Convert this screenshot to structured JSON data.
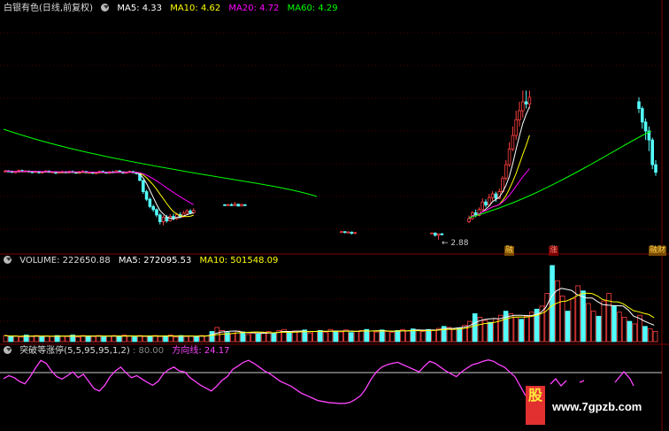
{
  "colors": {
    "background": "#000000",
    "up": "#ff4040",
    "down": "#54fcfc",
    "ma5": "#ffffff",
    "ma10": "#ffff00",
    "ma20": "#ff00ff",
    "ma60": "#00ff00",
    "vol_ma5": "#ffffff",
    "vol_ma10": "#ffff00",
    "indicator": "#ff44ff",
    "grid": "#7a0000"
  },
  "panels": {
    "price": {
      "title": "白银有色(日线,前复权)",
      "ma5": "MA5: 4.33",
      "ma10": "MA10: 4.62",
      "ma20": "MA20: 4.72",
      "ma60": "MA60: 4.29",
      "low_annotation": "← 2.88",
      "tag1": "融",
      "tag2": "涨",
      "tag3": "融财"
    },
    "volume": {
      "vol": "VOLUME: 222650.88",
      "ma5": "MA5: 272095.53",
      "ma10": "MA10: 501548.09"
    },
    "indicator": {
      "name": "突破等涨停(5,5,95,95,1,2)",
      "value": ": 80.00",
      "line_label": "方向线: 24.17"
    }
  },
  "watermark": {
    "text": "www.7gpzb.com",
    "logo": "股"
  },
  "chart_data": {
    "type": "candlestick",
    "panels": [
      "price",
      "volume",
      "indicator"
    ],
    "indicator_value": 80.0,
    "direction_line": 24.17,
    "candles": [
      [
        4.39,
        4.41,
        4.43,
        4.38
      ],
      [
        4.41,
        4.4,
        4.43,
        4.38
      ],
      [
        4.4,
        4.38,
        4.42,
        4.36
      ],
      [
        4.38,
        4.39,
        4.41,
        4.36
      ],
      [
        4.39,
        4.42,
        4.44,
        4.37
      ],
      [
        4.42,
        4.4,
        4.44,
        4.38
      ],
      [
        4.4,
        4.41,
        4.43,
        4.39
      ],
      [
        4.41,
        4.39,
        4.42,
        4.37
      ],
      [
        4.39,
        4.38,
        4.41,
        4.36
      ],
      [
        4.38,
        4.4,
        4.42,
        4.36
      ],
      [
        4.4,
        4.37,
        4.41,
        4.35
      ],
      [
        4.37,
        4.39,
        4.4,
        4.35
      ],
      [
        4.39,
        4.41,
        4.43,
        4.37
      ],
      [
        4.41,
        4.38,
        4.42,
        4.37
      ],
      [
        4.38,
        4.39,
        4.41,
        4.36
      ],
      [
        4.39,
        4.36,
        4.4,
        4.34
      ],
      [
        4.36,
        4.38,
        4.4,
        4.35
      ],
      [
        4.38,
        4.39,
        4.42,
        4.36
      ],
      [
        4.39,
        4.37,
        4.41,
        4.36
      ],
      [
        4.37,
        4.4,
        4.42,
        4.36
      ],
      [
        4.4,
        4.38,
        4.42,
        4.36
      ],
      [
        4.38,
        4.36,
        4.4,
        4.35
      ],
      [
        4.36,
        4.39,
        4.41,
        4.35
      ],
      [
        4.39,
        4.4,
        4.43,
        4.37
      ],
      [
        4.4,
        4.37,
        4.41,
        4.36
      ],
      [
        4.37,
        4.38,
        4.4,
        4.35
      ],
      [
        4.38,
        4.36,
        4.39,
        4.34
      ],
      [
        4.36,
        4.37,
        4.39,
        4.35
      ],
      [
        4.37,
        4.4,
        4.42,
        4.36
      ],
      [
        4.4,
        4.38,
        4.42,
        4.37
      ],
      [
        4.38,
        4.36,
        4.4,
        4.35
      ],
      [
        4.36,
        4.39,
        4.41,
        4.35
      ],
      [
        4.39,
        4.38,
        4.41,
        4.36
      ],
      [
        4.38,
        4.41,
        4.43,
        4.37
      ],
      [
        4.41,
        4.39,
        4.43,
        4.38
      ],
      [
        4.39,
        4.36,
        4.4,
        4.35
      ],
      [
        4.36,
        4.38,
        4.4,
        4.35
      ],
      [
        4.38,
        4.4,
        4.42,
        4.37
      ],
      [
        4.4,
        4.37,
        4.41,
        4.36
      ],
      [
        4.37,
        4.35,
        4.39,
        4.33
      ],
      [
        4.35,
        4.2,
        4.36,
        4.18
      ],
      [
        4.2,
        3.95,
        4.21,
        3.9
      ],
      [
        3.95,
        3.78,
        3.99,
        3.74
      ],
      [
        3.78,
        3.62,
        3.82,
        3.58
      ],
      [
        3.62,
        3.55,
        3.66,
        3.5
      ],
      [
        3.55,
        3.43,
        3.58,
        3.38
      ],
      [
        3.43,
        3.28,
        3.47,
        3.22
      ],
      [
        3.28,
        3.38,
        3.42,
        3.2
      ],
      [
        3.38,
        3.3,
        3.43,
        3.26
      ],
      [
        3.3,
        3.4,
        3.45,
        3.28
      ],
      [
        3.4,
        3.35,
        3.46,
        3.31
      ],
      [
        3.35,
        3.44,
        3.48,
        3.32
      ],
      [
        3.44,
        3.39,
        3.49,
        3.36
      ],
      [
        3.39,
        3.47,
        3.52,
        3.37
      ],
      [
        3.47,
        3.52,
        3.56,
        3.44
      ],
      [
        3.52,
        3.48,
        3.56,
        3.45
      ],
      [
        3.48,
        3.53,
        3.58,
        3.46
      ]
    ],
    "candles_segment2": [
      [
        3.66,
        3.64,
        3.67,
        3.63
      ],
      [
        3.64,
        3.66,
        3.68,
        3.63
      ],
      [
        3.66,
        3.64,
        3.69,
        3.63
      ],
      [
        3.64,
        3.67,
        3.72,
        3.63
      ],
      [
        3.67,
        3.63,
        3.68,
        3.62
      ],
      [
        3.63,
        3.66,
        3.69,
        3.62
      ],
      [
        3.66,
        3.64,
        3.67,
        3.63
      ]
    ],
    "candles_segment3": [
      [
        3.05,
        3.06,
        3.08,
        3.03
      ],
      [
        3.06,
        3.04,
        3.07,
        3.02
      ],
      [
        3.04,
        3.05,
        3.07,
        3.03
      ],
      [
        3.05,
        3.02,
        3.06,
        3.0
      ],
      [
        3.02,
        3.04,
        3.05,
        3.0
      ]
    ],
    "candles_segment4": [
      [
        3.02,
        3.03,
        3.04,
        3.01
      ],
      [
        3.03,
        2.98,
        3.04,
        2.95
      ],
      [
        2.98,
        3.01,
        3.02,
        2.88
      ],
      [
        3.01,
        3.0,
        3.03,
        2.98
      ]
    ],
    "candles_segment5": [
      [
        3.28,
        3.35,
        3.42,
        3.25
      ],
      [
        3.35,
        3.48,
        3.52,
        3.32
      ],
      [
        3.48,
        3.42,
        3.55,
        3.38
      ],
      [
        3.42,
        3.55,
        3.6,
        3.4
      ],
      [
        3.55,
        3.72,
        3.8,
        3.52
      ],
      [
        3.72,
        3.65,
        3.78,
        3.6
      ],
      [
        3.65,
        3.82,
        3.9,
        3.62
      ],
      [
        3.82,
        3.9,
        3.96,
        3.75
      ],
      [
        3.9,
        3.8,
        3.95,
        3.72
      ],
      [
        3.8,
        3.95,
        4.02,
        3.78
      ],
      [
        3.95,
        4.25,
        4.3,
        3.92
      ],
      [
        4.25,
        4.55,
        4.65,
        4.2
      ],
      [
        4.55,
        4.9,
        5.05,
        4.5
      ],
      [
        4.9,
        5.2,
        5.4,
        4.85
      ],
      [
        5.2,
        5.55,
        5.75,
        5.1
      ],
      [
        5.55,
        5.75,
        5.95,
        5.4
      ],
      [
        5.75,
        5.95,
        6.2,
        5.6
      ],
      [
        5.95,
        5.9,
        6.2,
        5.8
      ],
      [
        5.9,
        6.05,
        6.2,
        5.8
      ]
    ],
    "candles_segment6": [
      [
        5.95,
        5.8,
        6.05,
        5.7
      ],
      [
        5.8,
        5.5,
        5.85,
        5.35
      ],
      [
        5.5,
        5.3,
        5.58,
        5.1
      ],
      [
        5.3,
        5.1,
        5.4,
        4.85
      ],
      [
        5.1,
        4.55,
        5.15,
        4.45
      ],
      [
        4.55,
        4.38,
        4.65,
        4.3
      ]
    ],
    "volume": [
      12,
      10,
      11,
      9,
      13,
      10,
      12,
      9,
      11,
      10,
      12,
      11,
      10,
      13,
      9,
      12,
      11,
      10,
      12,
      9,
      11,
      12,
      10,
      13,
      11,
      9,
      12,
      10,
      11,
      12,
      10,
      11,
      13,
      9,
      12,
      10,
      11,
      10,
      12,
      11,
      20,
      28,
      22,
      18,
      16,
      21,
      19,
      14,
      17,
      15,
      18,
      20,
      16,
      22,
      24,
      18,
      21,
      19,
      23,
      17,
      20,
      22,
      18,
      24,
      21,
      19,
      23,
      18,
      20,
      22,
      24,
      21,
      19,
      23,
      20,
      18,
      22,
      24,
      21,
      25,
      23,
      20,
      24,
      22,
      26,
      30,
      28,
      24,
      27,
      32,
      40,
      55,
      48,
      42,
      38,
      45,
      52,
      60,
      55,
      48,
      44,
      50,
      58,
      64,
      70,
      95,
      150,
      120,
      90,
      60,
      85,
      110,
      100,
      75,
      60,
      50,
      80,
      95,
      70,
      58,
      48,
      40,
      35,
      52,
      30,
      25,
      20
    ],
    "indicator_series": [
      56,
      62,
      58,
      50,
      45,
      60,
      78,
      94,
      88,
      72,
      60,
      55,
      62,
      70,
      58,
      65,
      50,
      35,
      30,
      42,
      60,
      72,
      80,
      68,
      58,
      62,
      55,
      48,
      42,
      50,
      66,
      75,
      80,
      72,
      70,
      58,
      50,
      42,
      36,
      30,
      40,
      52,
      60,
      75,
      82,
      90,
      94,
      88,
      80,
      72,
      66,
      58,
      50,
      45,
      40,
      32,
      25,
      20,
      15,
      10,
      8,
      6,
      5,
      4,
      4,
      6,
      12,
      20,
      35,
      55,
      70,
      80,
      85,
      88,
      90,
      85,
      80,
      75,
      70,
      82,
      92,
      88,
      80,
      72,
      66,
      60,
      70,
      78,
      85,
      88,
      92,
      95,
      92,
      85,
      80,
      70,
      60,
      40,
      20
    ]
  }
}
